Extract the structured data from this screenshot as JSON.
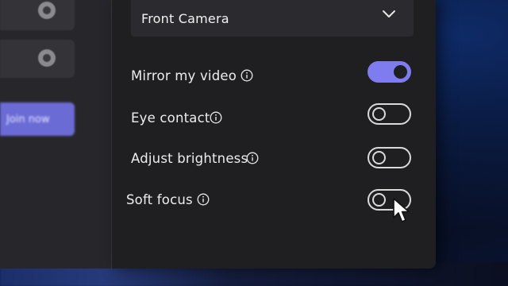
{
  "camera": {
    "selected": "Front Camera"
  },
  "join": {
    "label": "Join now"
  },
  "settings": [
    {
      "label": "Mirror my video",
      "on": true
    },
    {
      "label": "Eye contact",
      "on": false
    },
    {
      "label": "Adjust brightness",
      "on": false
    },
    {
      "label": "Soft focus",
      "on": false
    }
  ],
  "colors": {
    "accent": "#7f7cf0",
    "panel": "#1f1f22",
    "text": "#ededed"
  },
  "icons": {
    "info": "info-icon",
    "dropdown": "chevron-down-icon",
    "cursor": "mouse-pointer-icon"
  }
}
